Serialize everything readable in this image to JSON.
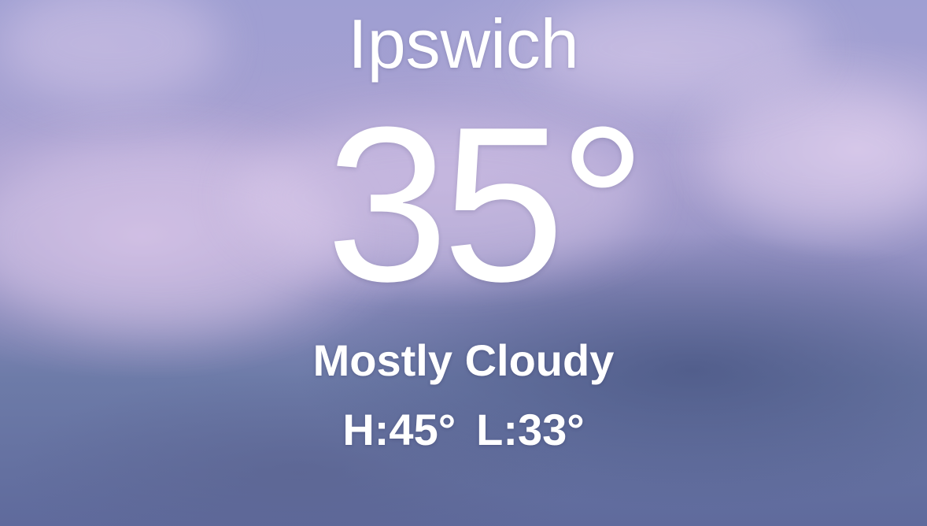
{
  "location": {
    "city": "Ipswich"
  },
  "current": {
    "temperature": "35°",
    "condition": "Mostly Cloudy",
    "high": "H:45°",
    "low": "L:33°"
  },
  "theme": {
    "background": "cloudy-sky",
    "sky_top": "#9f9fd2",
    "sky_bottom": "#5f6a9c",
    "text_color": "#ffffff"
  }
}
